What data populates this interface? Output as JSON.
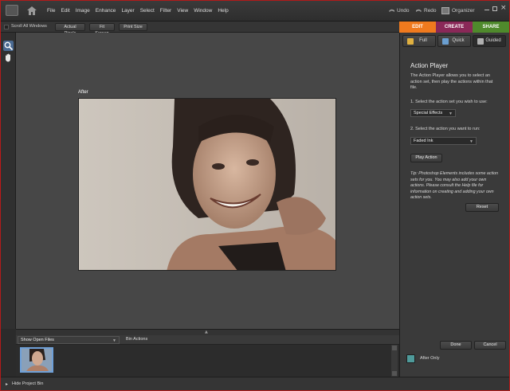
{
  "menu": {
    "items": [
      "File",
      "Edit",
      "Image",
      "Enhance",
      "Layer",
      "Select",
      "Filter",
      "View",
      "Window",
      "Help"
    ],
    "undo": "Undo",
    "redo": "Redo",
    "organizer": "Organizer"
  },
  "toolbar": {
    "scroll_all": "Scroll All Windows",
    "actual_pixels": "Actual Pixels",
    "fit_screen": "Fit Screen",
    "print_size": "Print Size"
  },
  "document": {
    "label": "After"
  },
  "modes": {
    "edit": "EDIT",
    "create": "CREATE",
    "share": "SHARE",
    "edit_color": "#f07a1e",
    "create_color": "#8a2858",
    "share_color": "#4f8a2c"
  },
  "subtabs": {
    "full": "Full",
    "quick": "Quick",
    "guided": "Guided"
  },
  "panel": {
    "title": "Action Player",
    "description": "The Action Player allows you to select an action set, then play the actions within that file.",
    "step1": "1. Select the action set you wish to use:",
    "action_set": "Special Effects",
    "step2": "2. Select the action you want to run:",
    "action": "Faded Ink",
    "play_button": "Play Action",
    "tips": "Tip: Photoshop Elements includes some action sets for you. You may also add your own actions. Please consult the Help file for information on creating and adding your own action sets.",
    "reset_button": "Reset",
    "done_button": "Done",
    "cancel_button": "Cancel",
    "after_only": "After Only"
  },
  "bin": {
    "show_files": "Show Open Files",
    "bin_actions": "Bin Actions",
    "hide_bin": "Hide Project Bin"
  }
}
